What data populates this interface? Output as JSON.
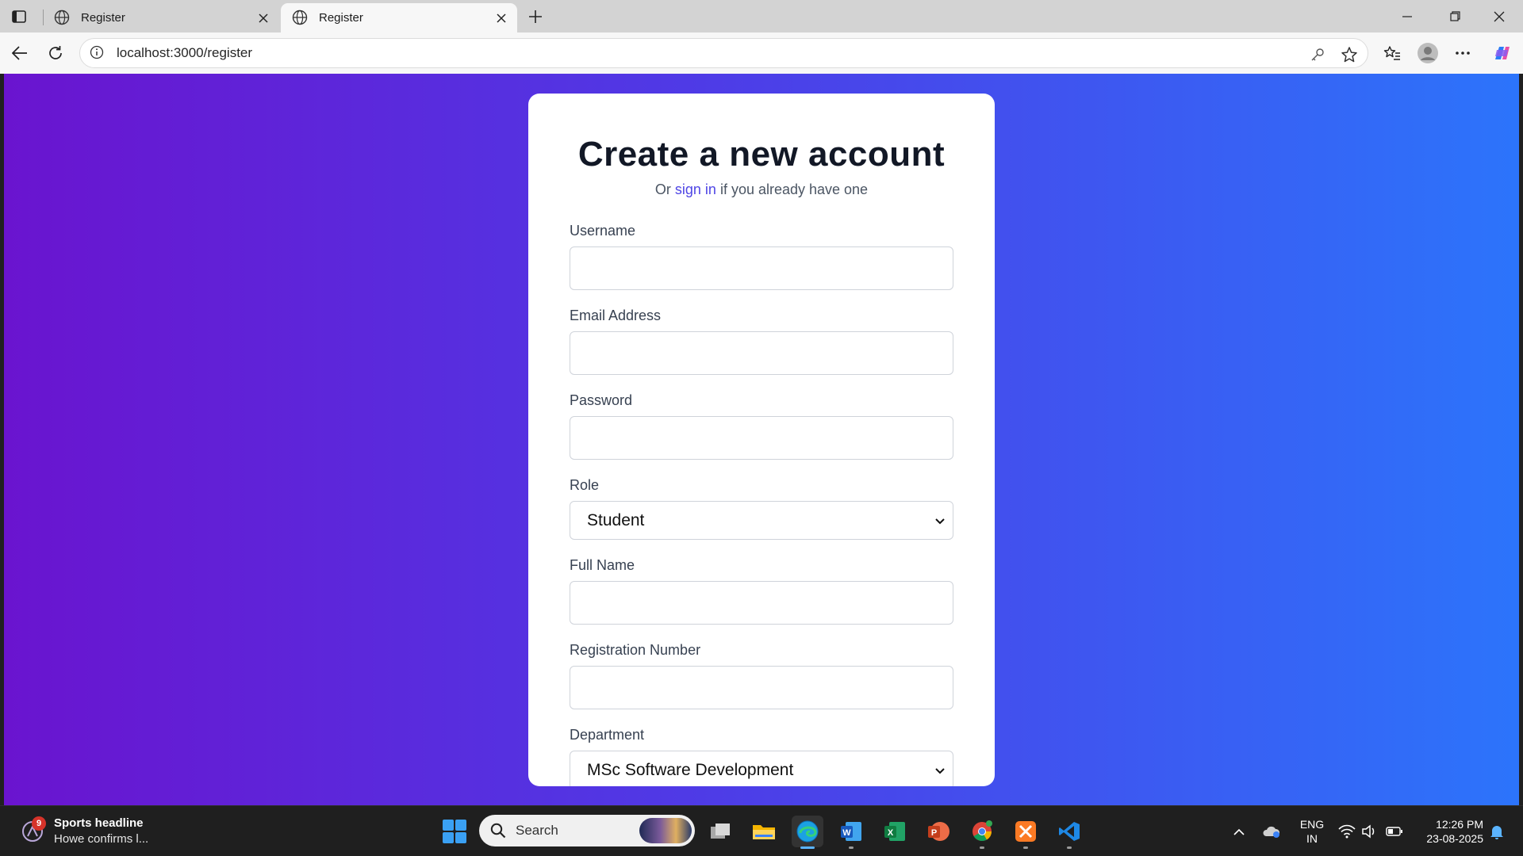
{
  "browser": {
    "tabs": [
      {
        "title": "Register",
        "active": false
      },
      {
        "title": "Register",
        "active": true
      }
    ],
    "url": "localhost:3000/register"
  },
  "page": {
    "heading": "Create a new account",
    "subtitle_prefix": "Or ",
    "subtitle_link": "sign in",
    "subtitle_suffix": " if you already have one",
    "fields": {
      "username_label": "Username",
      "username_value": "",
      "email_label": "Email Address",
      "email_value": "",
      "password_label": "Password",
      "password_value": "",
      "role_label": "Role",
      "role_value": "Student",
      "fullname_label": "Full Name",
      "fullname_value": "",
      "regno_label": "Registration Number",
      "regno_value": "",
      "department_label": "Department",
      "department_value": "MSc Software Development"
    },
    "colors": {
      "gradient_start": "#6a14cf",
      "gradient_end": "#2c74fb",
      "link": "#4f46e5"
    }
  },
  "taskbar": {
    "news_badge": "9",
    "news_title": "Sports headline",
    "news_sub": "Howe confirms l...",
    "search_placeholder": "Search",
    "lang_line1": "ENG",
    "lang_line2": "IN",
    "time": "12:26 PM",
    "date": "23-08-2025",
    "apps": [
      "task-view-icon",
      "file-explorer-icon",
      "edge-icon",
      "word-icon",
      "excel-icon",
      "powerpoint-icon",
      "chrome-icon",
      "xampp-icon",
      "vscode-icon"
    ]
  }
}
